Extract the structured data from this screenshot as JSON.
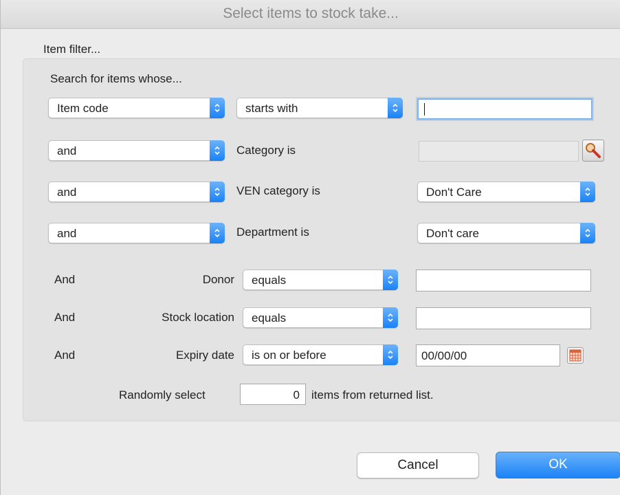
{
  "window": {
    "title": "Select items to stock take..."
  },
  "filter": {
    "group_label": "Item filter...",
    "intro": "Search for items whose...",
    "row1": {
      "field": "Item code",
      "operator": "starts with",
      "value": ""
    },
    "row2": {
      "conjunction": "and",
      "label": "Category is",
      "value": ""
    },
    "row3": {
      "conjunction": "and",
      "label": "VEN category is",
      "value": "Don't Care"
    },
    "row4": {
      "conjunction": "and",
      "label": "Department is",
      "value": "Don't care"
    },
    "row5": {
      "conjunction": "And",
      "label": "Donor",
      "operator": "equals",
      "value": ""
    },
    "row6": {
      "conjunction": "And",
      "label": "Stock location",
      "operator": "equals",
      "value": ""
    },
    "row7": {
      "conjunction": "And",
      "label": "Expiry date",
      "operator": "is on or before",
      "value": "00/00/00"
    },
    "random": {
      "prefix": "Randomly select",
      "count": "0",
      "suffix": "items from returned list."
    }
  },
  "buttons": {
    "cancel": "Cancel",
    "ok": "OK"
  },
  "icons": {
    "popup_arrows": "chevron-updown-icon",
    "lookup": "magnifier-icon",
    "calendar": "calendar-icon"
  },
  "colors": {
    "accent": "#1a82f6",
    "ok_button": "#3b94f8"
  }
}
